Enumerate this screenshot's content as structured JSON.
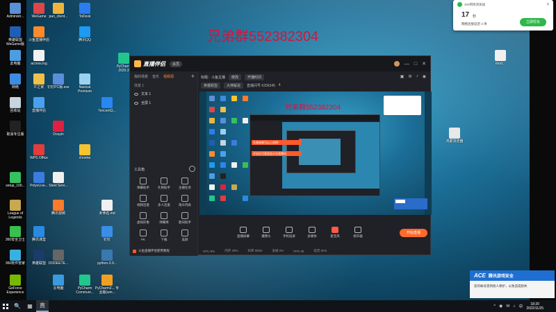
{
  "watermark": "兄弟群552382304",
  "desktop_icons": [
    {
      "label": "Administr...",
      "color": "#5b8fd6"
    },
    {
      "label": "WeGame",
      "color": "#e04646"
    },
    {
      "label": "pan_client...",
      "color": "#f0b43c"
    },
    {
      "label": "ToDesk",
      "color": "#2a7cf0"
    },
    {
      "label": "英雄联盟 WeGame版",
      "color": "#1e5fb4"
    },
    {
      "label": "斗鱼直播伴侣",
      "color": "#ff8a2a"
    },
    {
      "label": "腾讯QQ",
      "color": "#1c9bf0"
    },
    {
      "label": "此电脑",
      "color": "#4d9de0"
    },
    {
      "label": "access.log",
      "color": "#f2f2f2"
    },
    {
      "label": "PyCharm 2020.3",
      "color": "#22c68c"
    },
    {
      "label": "网络",
      "color": "#3c8de0"
    },
    {
      "label": "IT之家",
      "color": "#f0c048"
    },
    {
      "label": "钉钉PC版.exe",
      "color": "#5a8edc"
    },
    {
      "label": "Navicat Premium",
      "color": "#9ad0f0"
    },
    {
      "label": "回收站",
      "color": "#c8d4e0"
    },
    {
      "label": "直播伴侣",
      "color": "#4aa0f0"
    },
    {
      "label": "TencentQ...",
      "color": "#2a86f0"
    },
    {
      "label": "取消专注版",
      "color": "#222222"
    },
    {
      "label": "Douyin",
      "color": "#e02040"
    },
    {
      "label": "WPS Office",
      "color": "#e33c3c"
    },
    {
      "label": "chrome",
      "color": "#f4c430"
    },
    {
      "label": "setup_100...",
      "color": "#36c060"
    },
    {
      "label": "PolyvLive...",
      "color": "#3a7ce0"
    },
    {
      "label": "Steel Sere...",
      "color": "#f0f0f0"
    },
    {
      "label": "League of Legends",
      "color": "#c8a850"
    },
    {
      "label": "腾讯视频",
      "color": "#ff7a2a"
    },
    {
      "label": "未命名.md",
      "color": "#f0f0f0"
    },
    {
      "label": "360安全卫士",
      "color": "#3ac050"
    },
    {
      "label": "腾讯课堂",
      "color": "#2a8ae0"
    },
    {
      "label": "钉钉",
      "color": "#3a8ee8"
    },
    {
      "label": "360软件管家",
      "color": "#3ab0e0"
    },
    {
      "label": "英雄联盟",
      "color": "#1a3c6a"
    },
    {
      "label": "DODEETE...",
      "color": "#666666"
    },
    {
      "label": "python-3.9...",
      "color": "#3a78b0"
    },
    {
      "label": "GeForce Experience",
      "color": "#76b900"
    },
    {
      "label": "云电脑",
      "color": "#3a9ae0"
    },
    {
      "label": "PyCharm Communi...",
      "color": "#22c68c"
    },
    {
      "label": "PyCharm2... 专业版(win...",
      "color": "#f0a020"
    },
    {
      "label": "mod...",
      "color": "#f0f0f0"
    },
    {
      "label": "鸿蒙浏览器",
      "color": "#e8e8e8"
    }
  ],
  "app": {
    "logo": "直播伴侣",
    "version_badge": "会员",
    "window_controls": [
      "—",
      "□",
      "✕"
    ],
    "left_tabs": [
      "我的场景",
      "音乐",
      "视频源"
    ],
    "scene_label": "场景 1",
    "sources": [
      {
        "label": "文本 1"
      },
      {
        "label": "全屏 1"
      }
    ],
    "tools_header": "工具箱",
    "tools": [
      "弹幕助手",
      "礼物助手",
      "主播任务",
      "视频连麦",
      "多人连麦",
      "观众列表",
      "虚拟形象",
      "弹幕库",
      "歌词助手",
      "PK",
      "下载",
      "美颜"
    ],
    "left_status": "斗鱼直播伴侣使用教程",
    "top_row": [
      "标题：斗鱼主播",
      "修改",
      "开播时间"
    ],
    "second_row": [
      "英雄联盟",
      "大神解说",
      "直播间号 6256345",
      "4"
    ],
    "top_right_icons": [
      "通知",
      "设置",
      "消息",
      "用户"
    ],
    "bottom_tools": [
      "直播屏幕",
      "摄像头",
      "手机投屏",
      "多媒体",
      "麦克风",
      "扬声器"
    ],
    "start_button": "开始直播",
    "status": [
      "CPU 8%",
      "内存 40%",
      "码率 0kb/s",
      "丢帧 0%",
      "FPS 30",
      "延迟 0ms",
      "直播时长 00:00:00",
      "帧率 30"
    ]
  },
  "preview": {
    "watermark": "兄弟群552382304",
    "orange_items": [
      "礼物效果可以上热榜~",
      "开启后可直接显示在直播间"
    ]
  },
  "notify": {
    "header": "360网络测速器",
    "value": "17",
    "unit": "秒",
    "sub": "网络连接延迟 3 项",
    "button": "立即优化",
    "close": "✕"
  },
  "security": {
    "title": "腾讯游戏安全",
    "logo": "ACE",
    "body": "您的帐号受到他人保护，以免造成损失"
  },
  "taskbar": {
    "items": [
      "🔍",
      "▦",
      "直"
    ],
    "tray": [
      "^",
      "◉",
      "✉",
      "♪",
      "中"
    ],
    "time": "18:20",
    "date": "2022/11/25"
  },
  "colors": {
    "accent": "#ff6a2a",
    "watermark": "#d4143c",
    "notify_green": "#2eb84c",
    "security_blue": "#1e6fd1"
  }
}
